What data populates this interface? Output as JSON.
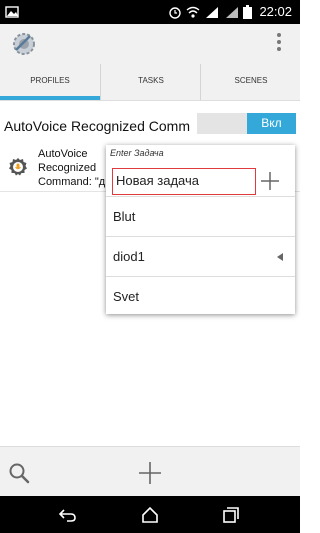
{
  "status_bar": {
    "time": "22:02",
    "icons": [
      "image-icon",
      "alarm-icon",
      "wifi-icon",
      "signal-icon",
      "signal-2g-icon",
      "battery-icon"
    ]
  },
  "app_bar": {
    "app_icon": "tasker-gear-icon",
    "menu_icon": "overflow-menu-icon"
  },
  "tabs": [
    {
      "label": "PROFILES",
      "active": true
    },
    {
      "label": "TASKS",
      "active": false
    },
    {
      "label": "SCENES",
      "active": false
    }
  ],
  "profile": {
    "title": "AutoVoice Recognized Comm",
    "toggle_label": "Вкл",
    "line1": "AutoVoice",
    "line2": "Recognized",
    "line3": "Command: \"д"
  },
  "task_popup": {
    "header": "Enter Задача",
    "new_task": "Новая задача",
    "items": [
      "Blut",
      "diod1",
      "Svet"
    ]
  },
  "bottom_bar": {
    "icons": [
      "search-icon",
      "add-icon"
    ]
  },
  "nav_bar": {
    "icons": [
      "back-icon",
      "home-icon",
      "recents-icon"
    ]
  },
  "colors": {
    "accent": "#33a8d9",
    "highlight_box": "#e0393e",
    "status_bar": "#000000"
  }
}
